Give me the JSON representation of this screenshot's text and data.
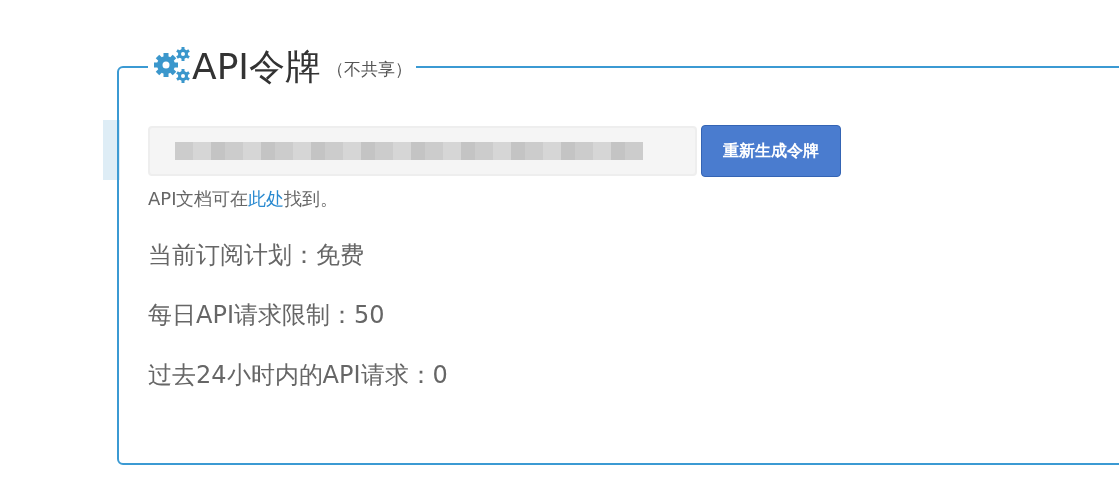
{
  "panel": {
    "title": "API令牌",
    "title_note": "（不共享）"
  },
  "token_field": {
    "redacted": true
  },
  "regenerate_button": {
    "label": "重新生成令牌"
  },
  "docs_note": {
    "before": "API文档可在",
    "link": "此处",
    "after": "找到。"
  },
  "info_lines": [
    "当前订阅计划：免费",
    "每日API请求限制：50",
    "过去24小时内的API请求：0"
  ]
}
